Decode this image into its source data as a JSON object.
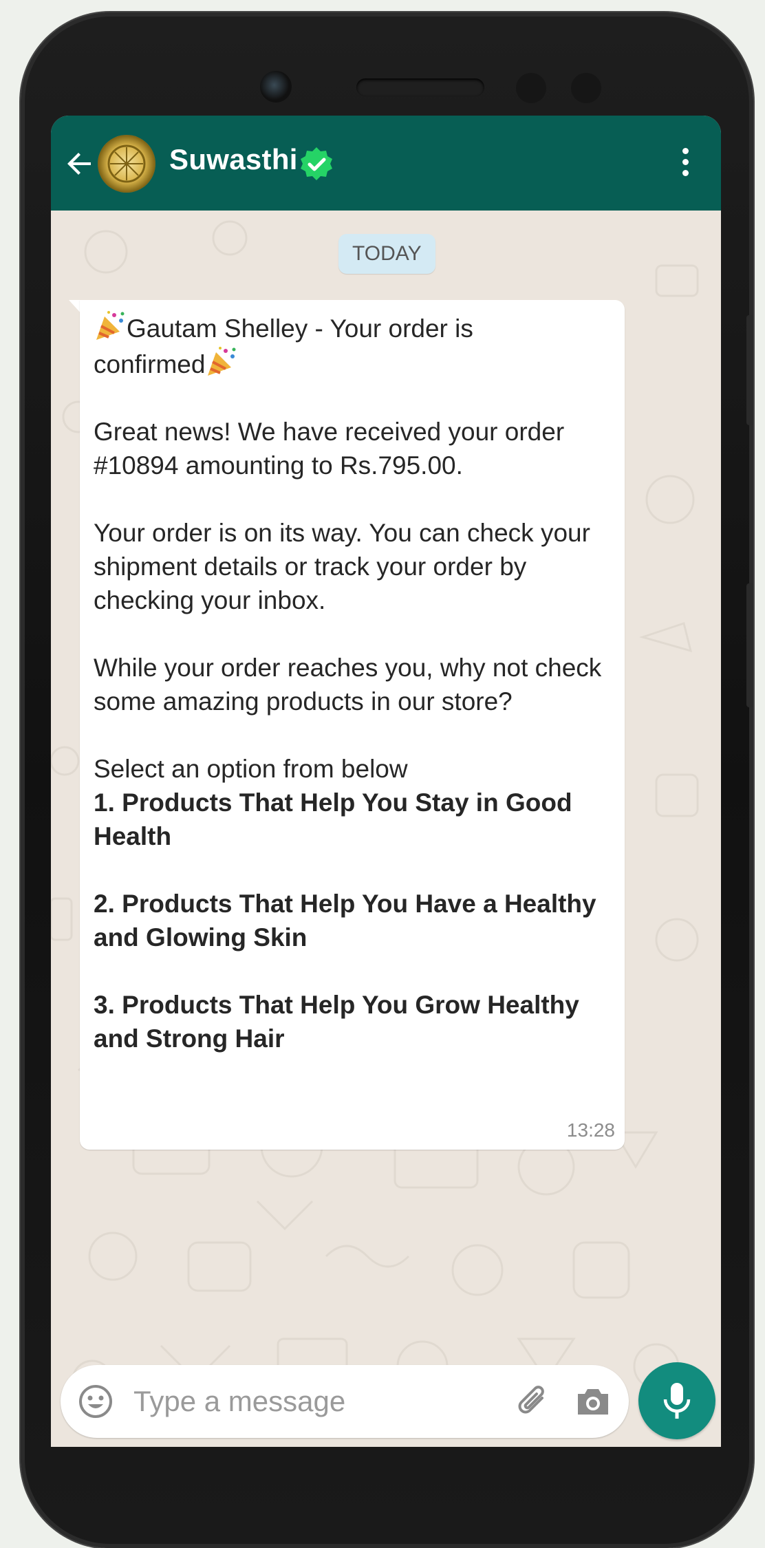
{
  "header": {
    "contact_name": "Suwasthi",
    "colors": {
      "header_bg": "#075e54",
      "verified": "#25d366"
    },
    "icons": [
      "back-arrow-icon",
      "avatar",
      "verified-badge-icon",
      "more-vert-icon"
    ]
  },
  "chat": {
    "date_label": "TODAY",
    "message": {
      "line_title_1": "Gautam Shelley - Your order is",
      "line_title_2": "confirmed",
      "para1": "Great news! We have received your order #10894 amounting to Rs.795.00.",
      "para2_a": "Your order is on its way. You can check your shipment details or track your order by",
      "para2_b": "checking your inbox.",
      "para3": "While your order reaches you, why not check some amazing products in our store?",
      "select_prompt": "Select an option from below",
      "option1": "1. Products That Help You Stay in Good Health",
      "option2": "2. Products That Help You Have a Healthy and Glowing Skin",
      "option3": "3. Products That Help You Grow Healthy and Strong Hair",
      "time": "13:28"
    }
  },
  "composer": {
    "placeholder": "Type a message",
    "icons": [
      "emoji-icon",
      "attach-icon",
      "camera-icon",
      "mic-icon"
    ]
  }
}
